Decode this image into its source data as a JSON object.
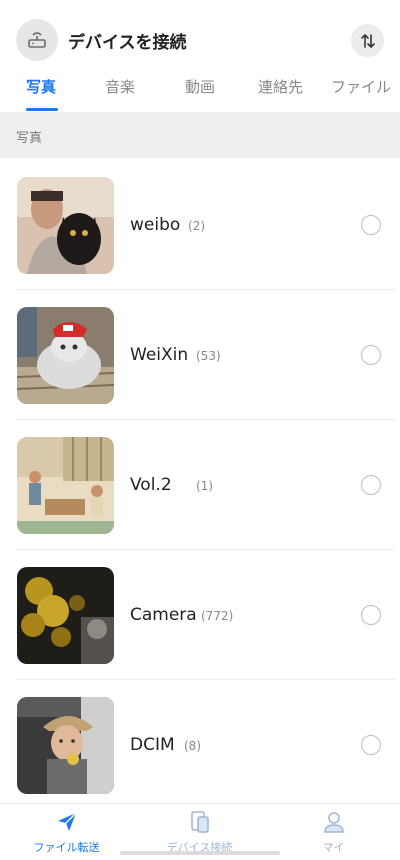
{
  "header": {
    "title": "デバイスを接続",
    "left_icon": "router-icon",
    "right_icon": "transfer-icon"
  },
  "tabs": [
    {
      "label": "写真",
      "active": true
    },
    {
      "label": "音楽",
      "active": false
    },
    {
      "label": "動画",
      "active": false
    },
    {
      "label": "連絡先",
      "active": false
    },
    {
      "label": "ファイル",
      "active": false
    }
  ],
  "section": {
    "title": "写真"
  },
  "albums": [
    {
      "name": "weibo",
      "count": "(2)"
    },
    {
      "name": "WeiXin",
      "count": "(53)"
    },
    {
      "name": "Vol.2",
      "count": "(1)"
    },
    {
      "name": "Camera",
      "count": "(772)"
    },
    {
      "name": "DCIM",
      "count": "(8)"
    }
  ],
  "bottom_nav": [
    {
      "label": "ファイル転送",
      "icon": "paper-plane-icon",
      "active": true
    },
    {
      "label": "デバイス接続",
      "icon": "devices-icon",
      "active": false
    },
    {
      "label": "マイ",
      "icon": "person-icon",
      "active": false
    }
  ],
  "colors": {
    "accent": "#1c78f0",
    "inactive_nav": "#9fb6d6",
    "section_bg": "#efefef"
  }
}
